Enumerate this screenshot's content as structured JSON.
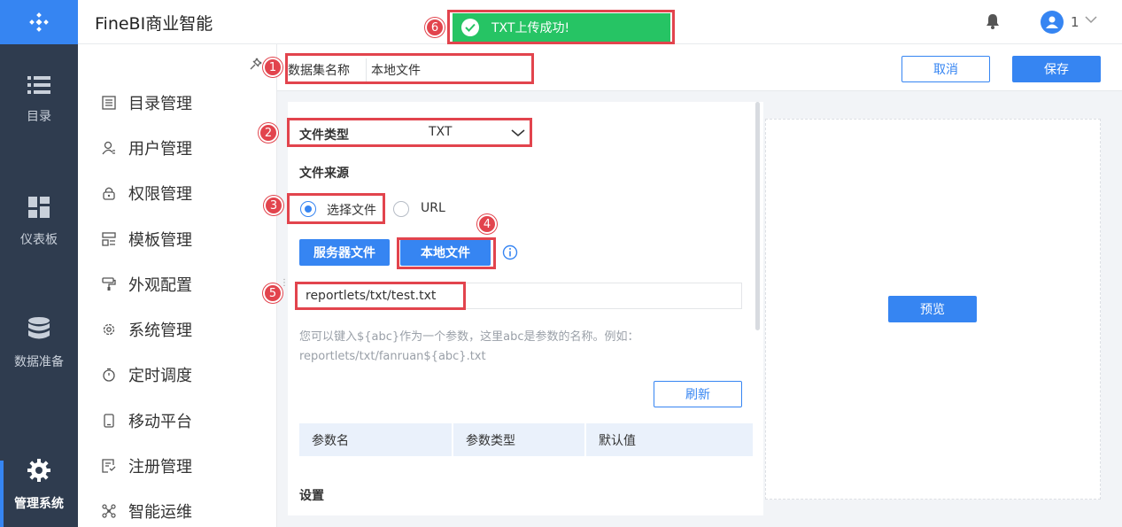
{
  "app": {
    "title": "FineBI商业智能",
    "brand_color": "#3685f2"
  },
  "rail": {
    "items": [
      {
        "label": "目录",
        "icon": "list-icon"
      },
      {
        "label": "仪表板",
        "icon": "dashboard-icon"
      },
      {
        "label": "数据准备",
        "icon": "database-icon"
      },
      {
        "label": "管理系统",
        "icon": "gear-icon",
        "active": true
      }
    ]
  },
  "header": {
    "user_name": "1"
  },
  "subnav": {
    "items": [
      {
        "label": "目录管理",
        "icon": "catalog-icon"
      },
      {
        "label": "用户管理",
        "icon": "user-icon"
      },
      {
        "label": "权限管理",
        "icon": "lock-icon"
      },
      {
        "label": "模板管理",
        "icon": "template-icon"
      },
      {
        "label": "外观配置",
        "icon": "brush-icon"
      },
      {
        "label": "系统管理",
        "icon": "settings-icon"
      },
      {
        "label": "定时调度",
        "icon": "timer-icon"
      },
      {
        "label": "移动平台",
        "icon": "mobile-icon"
      },
      {
        "label": "注册管理",
        "icon": "register-icon"
      },
      {
        "label": "智能运维",
        "icon": "network-icon"
      }
    ]
  },
  "dataset": {
    "name_label": "数据集名称",
    "name_value": "本地文件",
    "cancel_label": "取消",
    "save_label": "保存"
  },
  "form": {
    "file_type_label": "文件类型",
    "file_type_value": "TXT",
    "file_source_label": "文件来源",
    "radio_file_label": "选择文件",
    "radio_url_label": "URL",
    "server_file_label": "服务器文件",
    "local_file_label": "本地文件",
    "path_value": "reportlets/txt/test.txt",
    "hint_line1": "您可以键入${abc}作为一个参数，这里abc是参数的名称。例如：",
    "hint_line2": "reportlets/txt/fanruan${abc}.txt",
    "refresh_label": "刷新",
    "table_headers": [
      "参数名",
      "参数类型",
      "默认值"
    ],
    "settings_label": "设置"
  },
  "preview": {
    "button_label": "预览"
  },
  "toast": {
    "message": "TXT上传成功!",
    "color": "#26c464"
  },
  "annotations": [
    "1",
    "2",
    "3",
    "4",
    "5",
    "6"
  ]
}
